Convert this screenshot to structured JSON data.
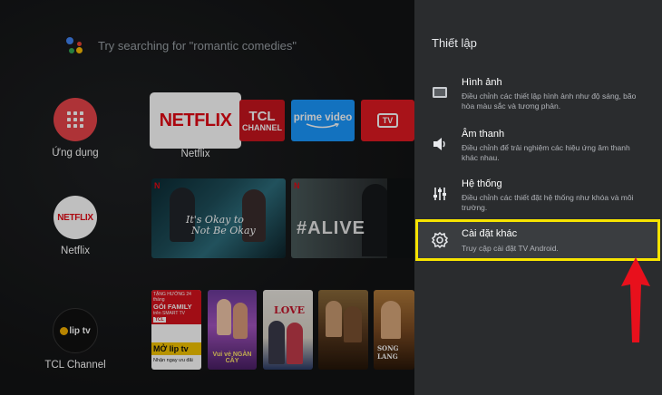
{
  "search": {
    "placeholder": "Try searching for \"romantic comedies\""
  },
  "apps_column": [
    {
      "label": "Ứng dụng",
      "icon": "apps-grid-icon"
    },
    {
      "label": "Netflix",
      "logo": "NETFLIX"
    },
    {
      "label": "TCL Channel",
      "logo": "lip tv"
    }
  ],
  "favorites": {
    "selected_label": "Netflix",
    "tiles": [
      {
        "name": "NETFLIX"
      },
      {
        "name": "TCL",
        "sub": "CHANNEL"
      },
      {
        "name": "prime video"
      },
      {
        "name": "TV"
      }
    ]
  },
  "netflix_row": {
    "posters": [
      {
        "title_line1": "It's Okay to",
        "title_line2": "Not Be Okay"
      },
      {
        "title": "#ALIVE"
      }
    ]
  },
  "tcl_row": {
    "promo": {
      "line1": "TẶNG HƯỚNG 24 tháng",
      "line2": "GÓI FAMILY",
      "line3": "trên SMART TV",
      "brand": "TCL",
      "logo": "MỞ  lip tv",
      "footer": "Nhận ngay ưu đãi"
    },
    "posters": [
      {
        "title": "Vui vẻ NGÀN CÂY"
      },
      {
        "title": "LOVE"
      },
      {
        "title": ""
      },
      {
        "title": "SONG LANG"
      }
    ]
  },
  "settings_panel": {
    "title": "Thiết lập",
    "items": [
      {
        "title": "Hình ảnh",
        "desc": "Điều chỉnh các thiết lập hình ảnh như độ sáng, bão hòa màu sắc và tương phản.",
        "icon": "picture-icon"
      },
      {
        "title": "Âm thanh",
        "desc": "Điều chỉnh để trải nghiệm các hiệu ứng âm thanh khác nhau.",
        "icon": "speaker-icon"
      },
      {
        "title": "Hệ thống",
        "desc": "Điều chỉnh các thiết đặt hệ thống như khóa và môi trường.",
        "icon": "sliders-icon"
      },
      {
        "title": "Cài đặt khác",
        "desc": "Truy cập cài đặt TV Android.",
        "icon": "gear-icon",
        "selected": true
      }
    ]
  },
  "colors": {
    "netflix_red": "#e50914",
    "highlight": "#f7e400",
    "arrow": "#e8101c",
    "panel_bg": "#2a2c2e"
  }
}
